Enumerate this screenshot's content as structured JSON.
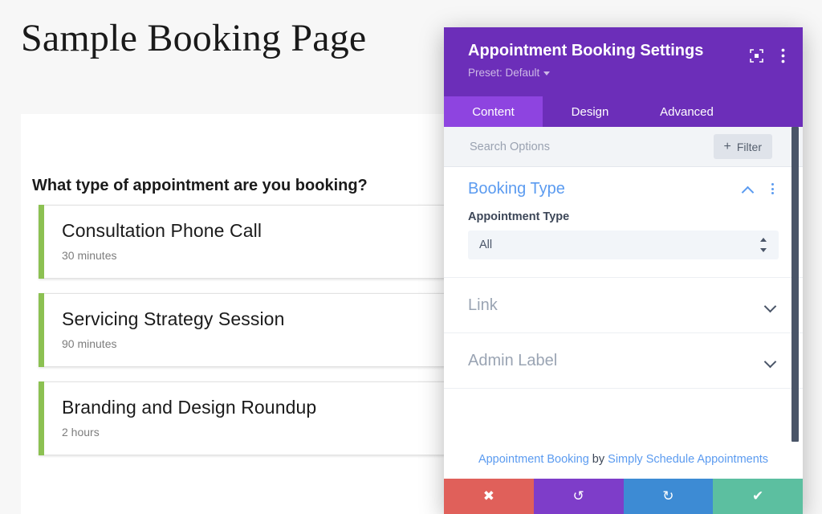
{
  "page": {
    "title": "Sample Booking Page",
    "question": "What type of appointment are you booking?",
    "bookings": [
      {
        "name": "Consultation Phone Call",
        "duration": "30 minutes"
      },
      {
        "name": "Servicing Strategy Session",
        "duration": "90 minutes"
      },
      {
        "name": "Branding and Design Roundup",
        "duration": "2 hours"
      }
    ],
    "accent_color": "#8cc152"
  },
  "settings": {
    "header": {
      "title": "Appointment Booking Settings",
      "preset_label": "Preset: Default",
      "focus_icon": "focus-frame-icon",
      "menu_icon": "kebab-menu-icon",
      "background_color": "#6c2eb9"
    },
    "tabs": [
      {
        "label": "Content",
        "active": true
      },
      {
        "label": "Design",
        "active": false
      },
      {
        "label": "Advanced",
        "active": false
      }
    ],
    "search": {
      "placeholder": "Search Options",
      "value": "",
      "filter_label": "Filter",
      "filter_plus": "+"
    },
    "sections": [
      {
        "title": "Booking Type",
        "state": "open",
        "chevron": "chevron-up-icon",
        "field_label": "Appointment Type",
        "field_value": "All",
        "options": [
          "All"
        ]
      },
      {
        "title": "Link",
        "state": "closed",
        "chevron": "chevron-down-icon"
      },
      {
        "title": "Admin Label",
        "state": "closed",
        "chevron": "chevron-down-icon"
      }
    ],
    "credit": {
      "product": "Appointment Booking",
      "by": " by ",
      "vendor": "Simply Schedule Appointments"
    },
    "actions": [
      {
        "name": "cancel",
        "glyph": "✖",
        "color": "#e0605a"
      },
      {
        "name": "undo",
        "glyph": "↺",
        "color": "#7e3dc9"
      },
      {
        "name": "redo",
        "glyph": "↻",
        "color": "#3d8bd4"
      },
      {
        "name": "save",
        "glyph": "✔",
        "color": "#5cbfa0"
      }
    ]
  }
}
